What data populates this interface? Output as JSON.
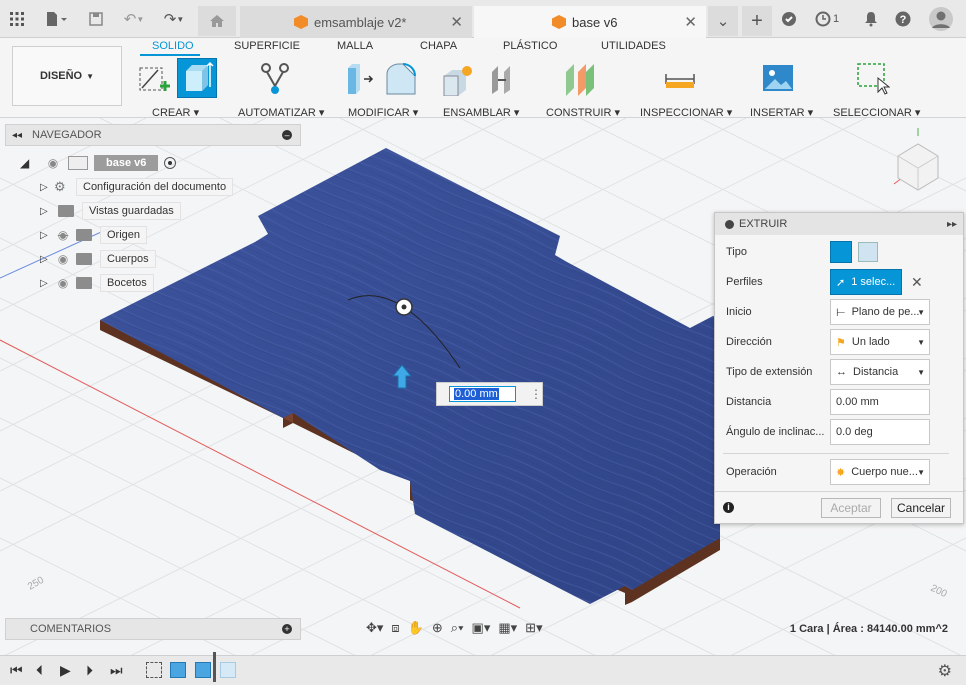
{
  "topbar": {
    "tabs": [
      {
        "label": "emsamblaje v2*",
        "active": false
      },
      {
        "label": "base v6",
        "active": true
      }
    ],
    "job_count": "1"
  },
  "ribbon": {
    "workspace": "DISEÑO",
    "tabs": [
      "SOLIDO",
      "SUPERFICIE",
      "MALLA",
      "CHAPA",
      "PLÁSTICO",
      "UTILIDADES"
    ],
    "groups": [
      "CREAR",
      "AUTOMATIZAR",
      "MODIFICAR",
      "ENSAMBLAR",
      "CONSTRUIR",
      "INSPECCIONAR",
      "INSERTAR",
      "SELECCIONAR"
    ]
  },
  "browser": {
    "title": "NAVEGADOR",
    "root": "base v6",
    "items": [
      {
        "label": "Configuración del documento",
        "icon": "gear-icon"
      },
      {
        "label": "Vistas guardadas",
        "icon": "folder-icon"
      },
      {
        "label": "Origen",
        "icon": "folder-icon"
      },
      {
        "label": "Cuerpos",
        "icon": "folder-icon"
      },
      {
        "label": "Bocetos",
        "icon": "folder-icon"
      }
    ]
  },
  "extrude": {
    "title": "EXTRUIR",
    "rows": [
      {
        "label": "Tipo"
      },
      {
        "label": "Perfiles",
        "value": "1 selec..."
      },
      {
        "label": "Inicio",
        "value": "Plano de pe..."
      },
      {
        "label": "Dirección",
        "value": "Un lado"
      },
      {
        "label": "Tipo de extensión",
        "value": "Distancia"
      },
      {
        "label": "Distancia",
        "value": "0.00 mm"
      },
      {
        "label": "Ángulo de inclinac...",
        "value": "0.0 deg"
      },
      {
        "label": "Operación",
        "value": "Cuerpo nue..."
      }
    ],
    "ok": "Aceptar",
    "cancel": "Cancelar"
  },
  "viewport": {
    "input_value": "0.00 mm",
    "axis_labels": [
      "250",
      "200"
    ],
    "status": "1 Cara | Área : 84140.00 mm^2"
  },
  "comments": {
    "title": "COMENTARIOS"
  },
  "colors": {
    "accent": "#0696d7",
    "plate": "#3b4f95",
    "edge": "#6b3b26"
  }
}
